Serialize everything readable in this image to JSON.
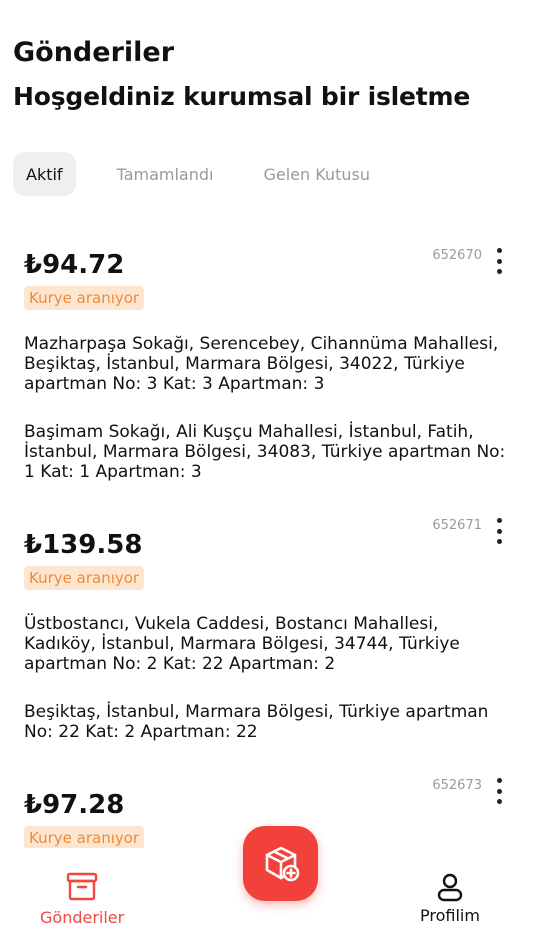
{
  "header": {
    "title": "Gönderiler",
    "subtitle": "Hoşgeldiniz kurumsal bir isletme"
  },
  "tabs": [
    {
      "label": "Aktif",
      "active": true
    },
    {
      "label": "Tamamlandı",
      "active": false
    },
    {
      "label": "Gelen Kutusu",
      "active": false
    }
  ],
  "orders": [
    {
      "price": "₺94.72",
      "id": "652670",
      "status": "Kurye aranıyor",
      "pickup": "Mazharpaşa Sokağı, Serencebey, Cihannüma Mahallesi, Beşiktaş, İstanbul, Marmara Bölgesi, 34022, Türkiye apartman No: 3 Kat: 3 Apartman: 3",
      "dropoff": "Başimam Sokağı, Ali Kuşçu Mahallesi, İstanbul, Fatih, İstanbul, Marmara Bölgesi, 34083, Türkiye apartman No: 1 Kat: 1 Apartman: 3"
    },
    {
      "price": "₺139.58",
      "id": "652671",
      "status": "Kurye aranıyor",
      "pickup": "Üstbostancı, Vukela Caddesi, Bostancı Mahallesi, Kadıköy, İstanbul, Marmara Bölgesi, 34744, Türkiye apartman No: 2 Kat: 22 Apartman: 2",
      "dropoff": "Beşiktaş, İstanbul, Marmara Bölgesi, Türkiye apartman No: 22 Kat: 2 Apartman: 22"
    },
    {
      "price": "₺97.28",
      "id": "652673",
      "status": "Kurye aranıyor"
    }
  ],
  "bottom_nav": {
    "left_label": "Gönderiler",
    "right_label": "Profilim",
    "accent_color": "#f2403b"
  },
  "icons": {
    "left": "package-icon",
    "center": "add-package-icon",
    "right": "user-icon",
    "more": "more-vertical-icon"
  }
}
